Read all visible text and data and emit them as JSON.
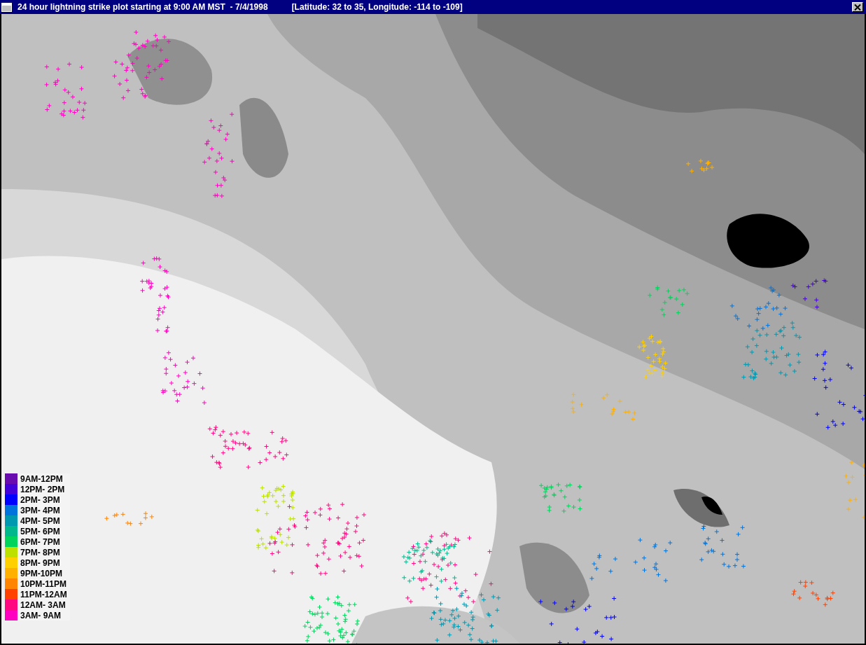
{
  "window": {
    "title": "24 hour lightning strike plot starting at 9:00 AM MST  - 7/4/1998",
    "subtitle": "[Latitude: 32 to 35, Longitude: -114 to -109]"
  },
  "legend": [
    {
      "label": "9AM-12PM",
      "color": "#6a0bb0"
    },
    {
      "label": "12PM- 2PM",
      "color": "#4400d8"
    },
    {
      "label": "2PM- 3PM",
      "color": "#0000ff"
    },
    {
      "label": "3PM- 4PM",
      "color": "#0074dc"
    },
    {
      "label": "4PM- 5PM",
      "color": "#0098b0"
    },
    {
      "label": "5PM- 6PM",
      "color": "#00b88c"
    },
    {
      "label": "6PM- 7PM",
      "color": "#00d45c"
    },
    {
      "label": "7PM- 8PM",
      "color": "#bce000"
    },
    {
      "label": "8PM- 9PM",
      "color": "#ffd000"
    },
    {
      "label": "9PM-10PM",
      "color": "#ffb000"
    },
    {
      "label": "10PM-11PM",
      "color": "#ff8400"
    },
    {
      "label": "11PM-12AM",
      "color": "#ff4000"
    },
    {
      "label": "12AM- 3AM",
      "color": "#ff0880"
    },
    {
      "label": "3AM- 9AM",
      "color": "#ff00c0"
    }
  ]
}
